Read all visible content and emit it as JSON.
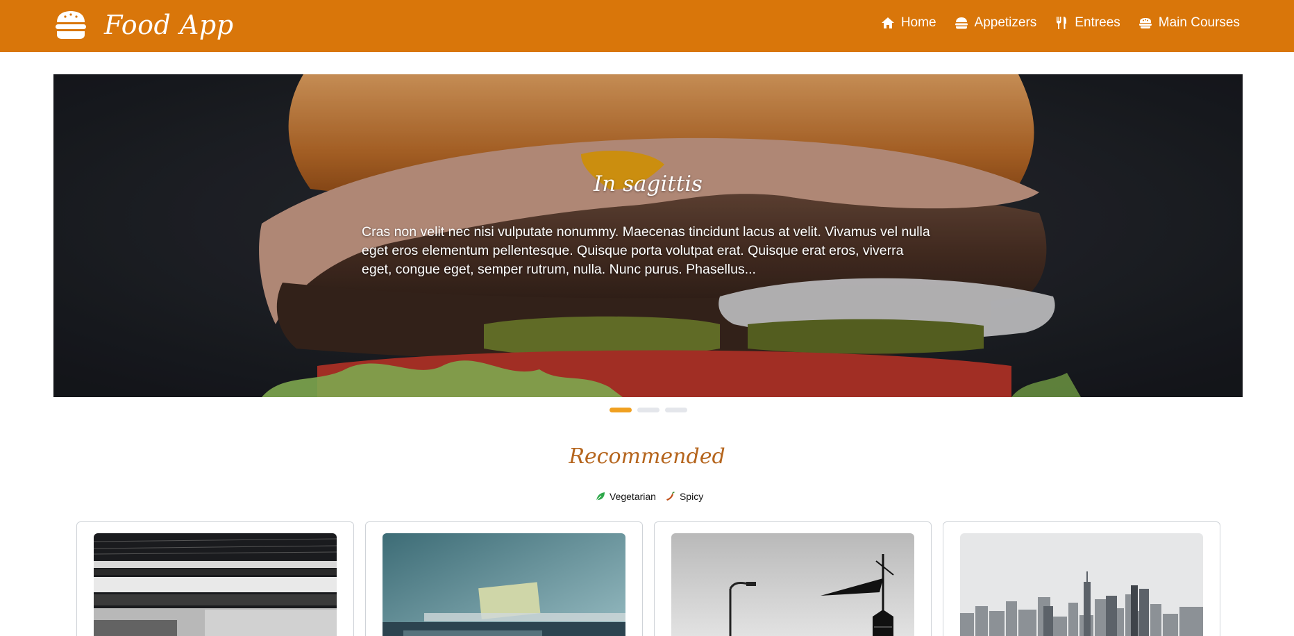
{
  "header": {
    "brand": "Food App",
    "brand_icon": "burger-icon",
    "nav": [
      {
        "label": "Home",
        "icon": "home-icon"
      },
      {
        "label": "Appetizers",
        "icon": "burger-icon"
      },
      {
        "label": "Entrees",
        "icon": "utensils-icon"
      },
      {
        "label": "Main Courses",
        "icon": "stroopwafel-icon"
      }
    ]
  },
  "carousel": {
    "title": "In sagittis",
    "text": "Cras non velit nec nisi vulputate nonummy. Maecenas tincidunt lacus at velit. Vivamus vel nulla eget eros elementum pellentesque. Quisque porta volutpat erat. Quisque erat eros, viverra eget, congue eget, semper rutrum, nulla. Nunc purus. Phasellus...",
    "slides": 3,
    "active_slide": 1
  },
  "recommended": {
    "title": "Recommended",
    "legend": [
      {
        "label": "Vegetarian",
        "icon": "leaf-icon",
        "color": "#2ea84a"
      },
      {
        "label": "Spicy",
        "icon": "pepper-icon",
        "color": "#c0501a"
      }
    ],
    "cards": [
      {
        "image": "subway-blur-photo"
      },
      {
        "image": "desk-blur-photo"
      },
      {
        "image": "windvane-photo"
      },
      {
        "image": "skyline-photo"
      }
    ]
  },
  "colors": {
    "header": "#d9760a",
    "accent": "#f0a020",
    "section_title": "#b5651d"
  }
}
